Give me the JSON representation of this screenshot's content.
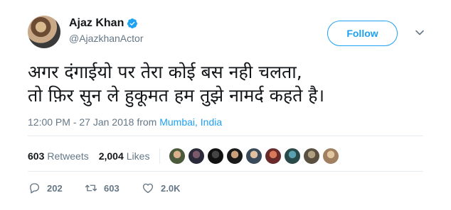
{
  "user": {
    "display_name": "Ajaz Khan",
    "handle": "@AjazkhanActor",
    "follow_label": "Follow"
  },
  "tweet": {
    "lines": [
      "अगर दंगाईयो पर तेरा कोई बस नही चलता,",
      "तो फ़िर सुन ले हुकूमत हम तुझे नामर्द कहते है।"
    ],
    "timestamp": "12:00 PM - 27 Jan 2018 from ",
    "location": "Mumbai, India"
  },
  "stats": {
    "retweets_count": "603",
    "retweets_label": "Retweets",
    "likes_count": "2,004",
    "likes_label": "Likes"
  },
  "actions": {
    "reply_count": "202",
    "retweet_count": "603",
    "like_count": "2.0K"
  },
  "colors": {
    "accent": "#1da1f2",
    "muted": "#657786",
    "text": "#14171a"
  },
  "icons": [
    "verified-badge-icon",
    "chevron-down-icon",
    "reply-icon",
    "retweet-icon",
    "heart-icon"
  ]
}
